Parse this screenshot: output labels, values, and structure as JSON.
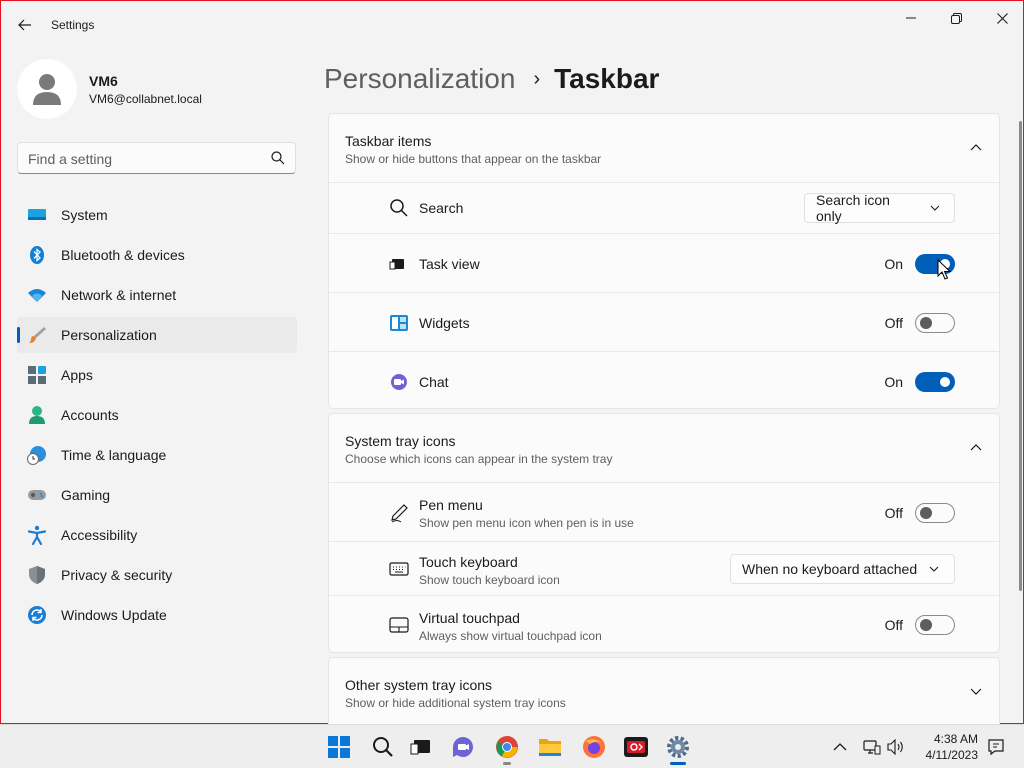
{
  "window": {
    "title": "Settings",
    "minimize_icon": "minimize-icon",
    "maximize_icon": "restore-icon",
    "close_icon": "close-icon"
  },
  "profile": {
    "name": "VM6",
    "email": "VM6@collabnet.local"
  },
  "search": {
    "placeholder": "Find a setting"
  },
  "sidebar": {
    "items": [
      {
        "label": "System",
        "icon": "system-icon"
      },
      {
        "label": "Bluetooth & devices",
        "icon": "bluetooth-icon"
      },
      {
        "label": "Network & internet",
        "icon": "wifi-icon"
      },
      {
        "label": "Personalization",
        "icon": "brush-icon",
        "active": true
      },
      {
        "label": "Apps",
        "icon": "apps-icon"
      },
      {
        "label": "Accounts",
        "icon": "accounts-icon"
      },
      {
        "label": "Time & language",
        "icon": "globe-clock-icon"
      },
      {
        "label": "Gaming",
        "icon": "gamepad-icon"
      },
      {
        "label": "Accessibility",
        "icon": "accessibility-icon"
      },
      {
        "label": "Privacy & security",
        "icon": "shield-icon"
      },
      {
        "label": "Windows Update",
        "icon": "update-icon"
      }
    ]
  },
  "breadcrumb": {
    "parent": "Personalization",
    "separator": "›",
    "current": "Taskbar"
  },
  "sections": {
    "taskbar_items": {
      "title": "Taskbar items",
      "desc": "Show or hide buttons that appear on the taskbar",
      "rows": {
        "search": {
          "label": "Search",
          "value": "Search icon only"
        },
        "task_view": {
          "label": "Task view",
          "state": "On",
          "on": true
        },
        "widgets": {
          "label": "Widgets",
          "state": "Off",
          "on": false
        },
        "chat": {
          "label": "Chat",
          "state": "On",
          "on": true
        }
      }
    },
    "system_tray": {
      "title": "System tray icons",
      "desc": "Choose which icons can appear in the system tray",
      "rows": {
        "pen_menu": {
          "label": "Pen menu",
          "sub": "Show pen menu icon when pen is in use",
          "state": "Off",
          "on": false
        },
        "touch_keyboard": {
          "label": "Touch keyboard",
          "sub": "Show touch keyboard icon",
          "value": "When no keyboard attached"
        },
        "virtual_touchpad": {
          "label": "Virtual touchpad",
          "sub": "Always show virtual touchpad icon",
          "state": "Off",
          "on": false
        }
      }
    },
    "other_tray": {
      "title": "Other system tray icons",
      "desc": "Show or hide additional system tray icons"
    }
  },
  "taskbar": {
    "apps": [
      "windows-start-icon",
      "search-icon",
      "task-view-icon",
      "chat-icon",
      "chrome-icon",
      "file-explorer-icon",
      "firefox-icon",
      "screen-recorder-icon",
      "settings-icon"
    ],
    "clock": {
      "time": "4:38 AM",
      "date": "4/11/2023"
    }
  },
  "colors": {
    "accent": "#005fb8",
    "background": "#f3f3f3",
    "card": "#fbfbfb"
  }
}
